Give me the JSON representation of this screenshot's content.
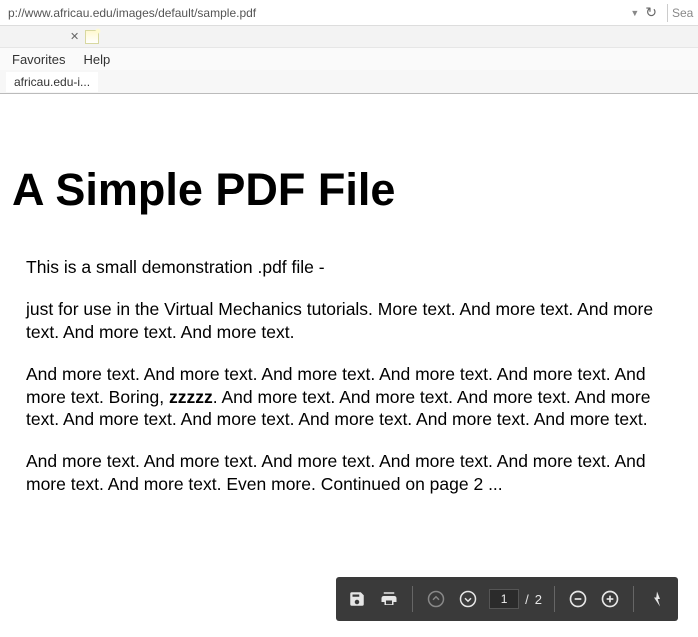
{
  "browser": {
    "url": "p://www.africau.edu/images/default/sample.pdf",
    "search_placeholder": "Sear",
    "menu": {
      "favorites": "Favorites",
      "help": "Help"
    },
    "tab_label": "africau.edu-i..."
  },
  "pdf": {
    "title": "A Simple PDF File",
    "p1": "This is a small demonstration .pdf file -",
    "p2": "just for use in the Virtual Mechanics tutorials. More text. And more text. And more text. And more text. And more text.",
    "p3_a": "And more text. And more text. And more text. And more text. And more text. And more text. Boring, ",
    "p3_bold": "zzzzz",
    "p3_b": ". And more text. And more text. And more text. And more text. And more text. And more text. And more text. And more text. And more text.",
    "p4": "And more text. And more text. And more text. And more text. And more text. And more text. And more text. Even more. Continued on page 2 ..."
  },
  "toolbar": {
    "current_page": "1",
    "page_sep": "/",
    "total_pages": "2"
  }
}
